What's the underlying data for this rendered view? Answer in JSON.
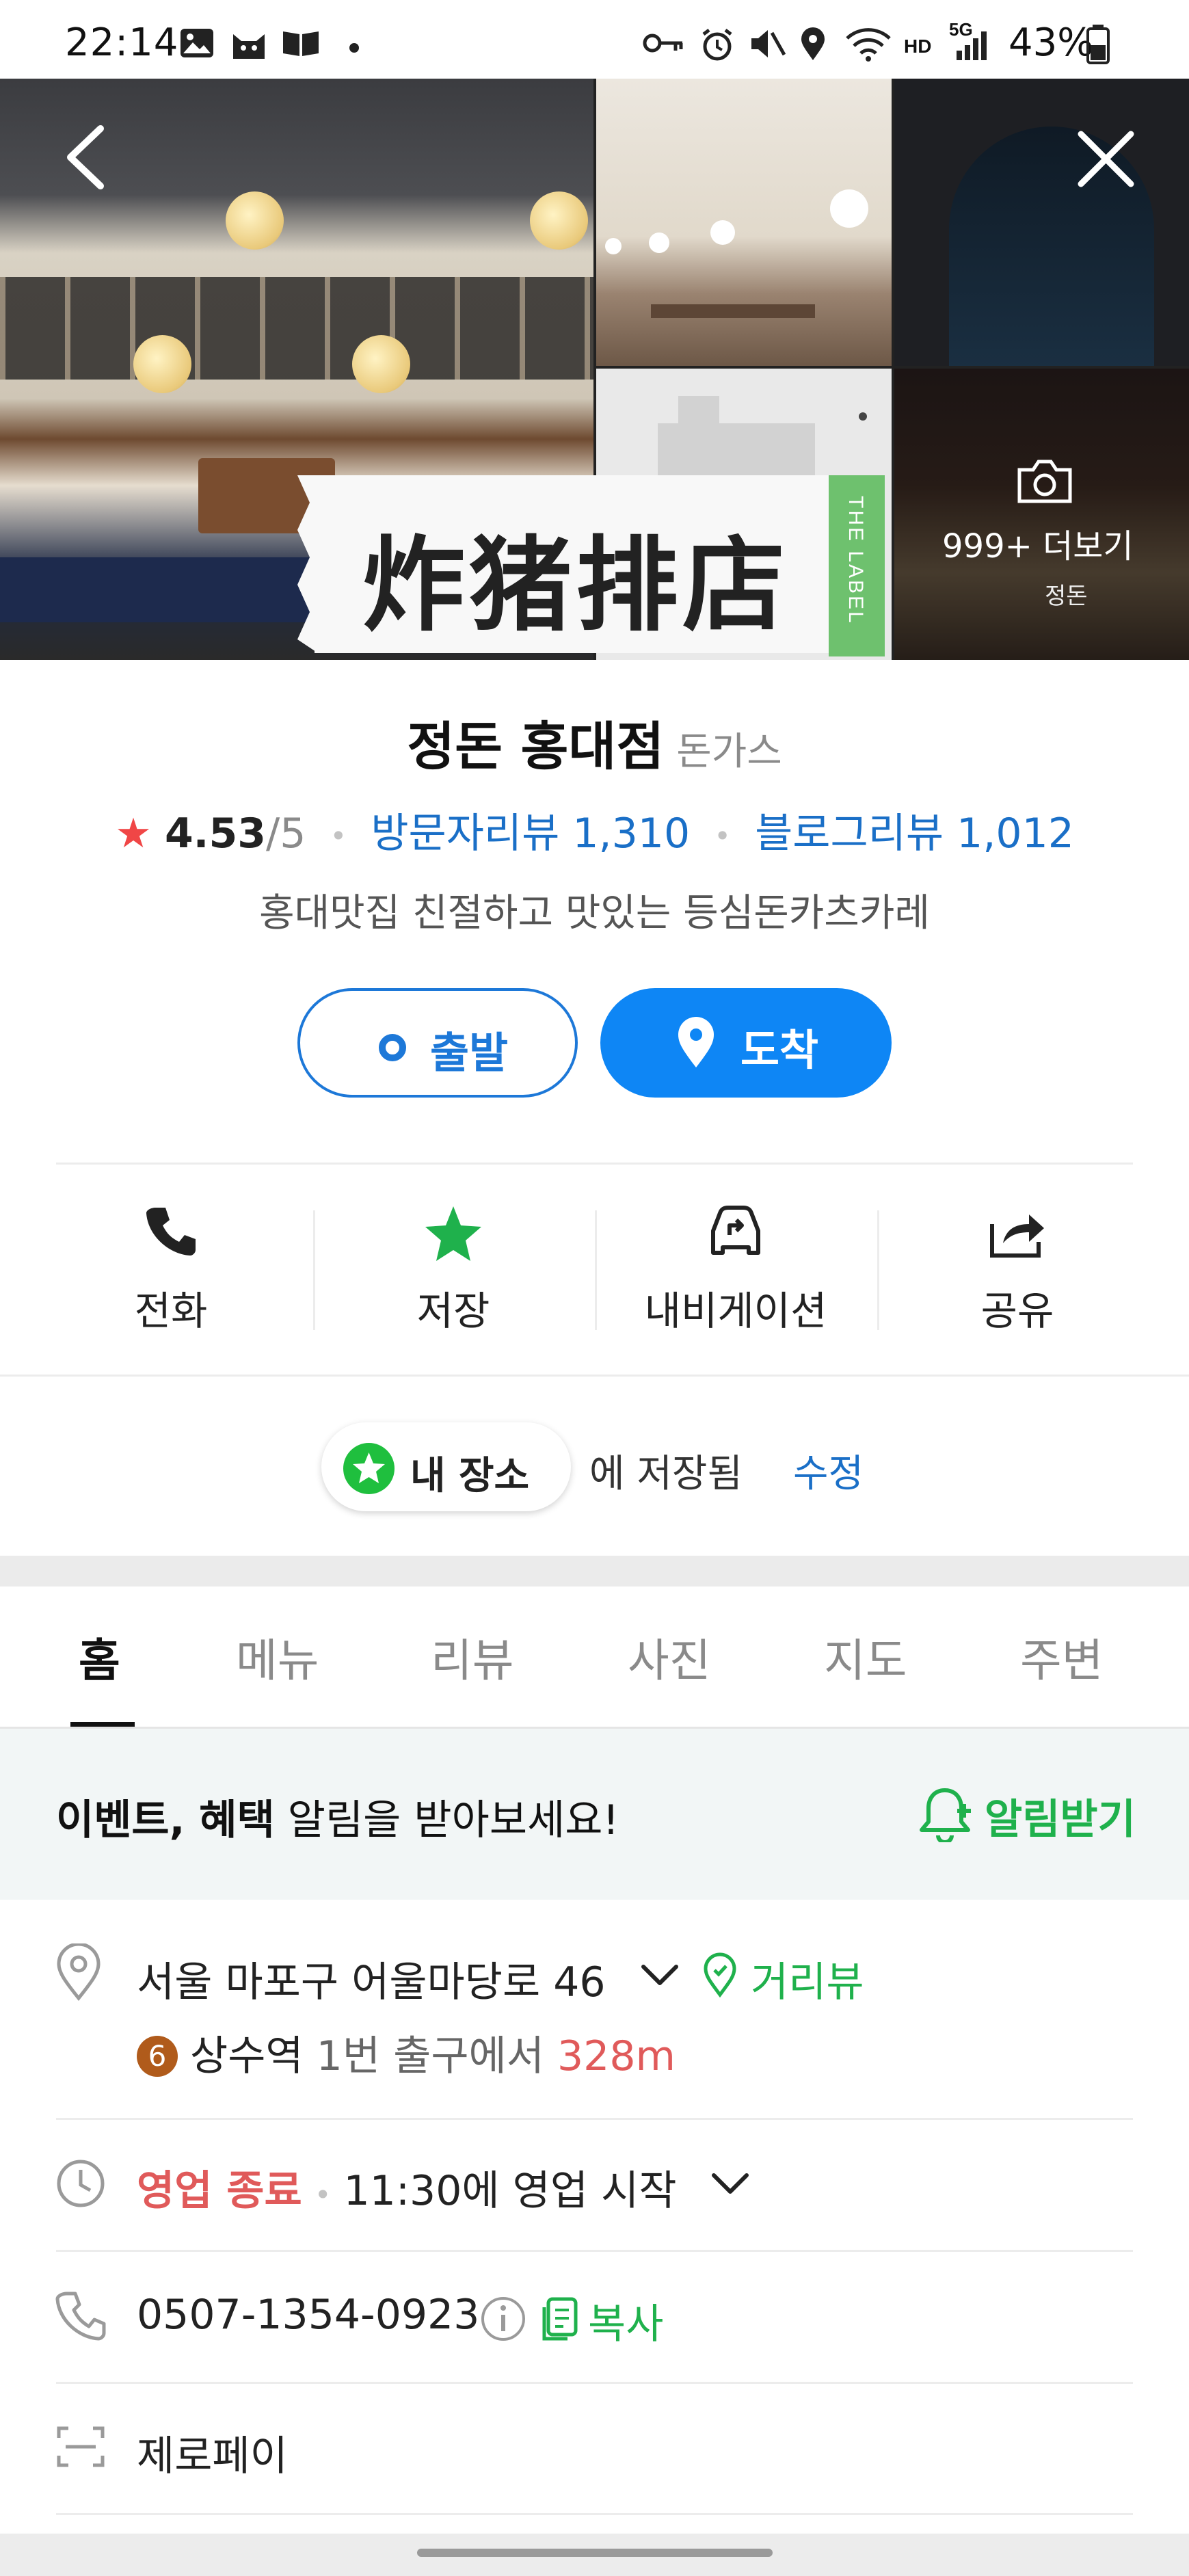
{
  "status_bar": {
    "time": "22:14",
    "battery": "43%",
    "network": "5G",
    "hd_label": "HD"
  },
  "hero": {
    "photo_title_overlay": "炸猪排店",
    "vertical_tag": "THE LABEL",
    "more_photos": "999+ 더보기",
    "shop_sign_text": "정돈"
  },
  "place": {
    "name": "정돈 홍대점",
    "category": "돈가스",
    "rating": "4.53",
    "rating_max": "/5",
    "visitor_reviews_label": "방문자리뷰 1,310",
    "blog_reviews_label": "블로그리뷰 1,012",
    "description": "홍대맛집 친절하고 맛있는 등심돈카츠카레"
  },
  "route": {
    "start_label": "출발",
    "arrive_label": "도착"
  },
  "actions": [
    {
      "label": "전화",
      "icon": "phone-icon"
    },
    {
      "label": "저장",
      "icon": "star-icon",
      "active": true
    },
    {
      "label": "내비게이션",
      "icon": "car-navigation-icon"
    },
    {
      "label": "공유",
      "icon": "share-icon"
    }
  ],
  "saved": {
    "chip_label": "내 장소",
    "text": "에 저장됨",
    "edit": "수정"
  },
  "tabs": [
    "홈",
    "메뉴",
    "리뷰",
    "사진",
    "지도",
    "주변"
  ],
  "notice": {
    "bold": "이벤트, 혜택",
    "rest": " 알림을 받아보세요!",
    "button": "알림받기"
  },
  "info": {
    "address": "서울 마포구 어울마당로 46",
    "street_view": "거리뷰",
    "subway_line": "6",
    "station": "상수역",
    "exit_text": " 1번 출구에서 ",
    "distance": "328m",
    "status": "영업 종료",
    "opening": "11:30에 영업 시작",
    "phone": "0507-1354-0923",
    "copy": "복사",
    "zeropay": "제로페이"
  },
  "colors": {
    "brand_green": "#1fb14c",
    "link_blue": "#1a6fc7",
    "route_blue": "#0e86f5",
    "closed_red": "#e05a5a",
    "star_red": "#f04646"
  }
}
